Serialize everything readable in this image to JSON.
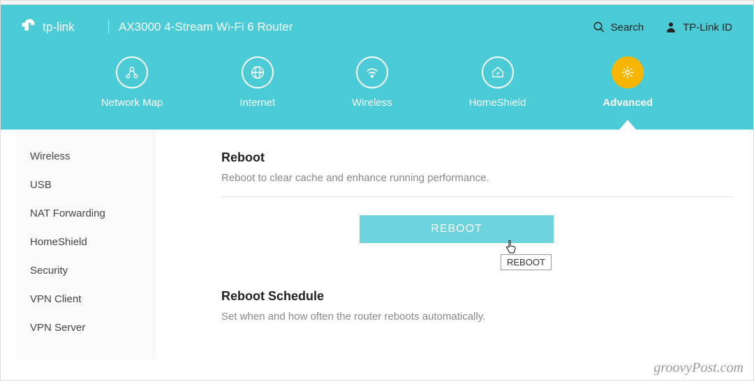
{
  "brand": {
    "name": "tp-link",
    "model": "AX3000 4-Stream Wi-Fi 6 Router"
  },
  "header_actions": {
    "search": "Search",
    "account": "TP-Link ID"
  },
  "nav": [
    {
      "id": "network-map",
      "label": "Network Map",
      "active": false
    },
    {
      "id": "internet",
      "label": "Internet",
      "active": false
    },
    {
      "id": "wireless",
      "label": "Wireless",
      "active": false
    },
    {
      "id": "homeshield",
      "label": "HomeShield",
      "active": false
    },
    {
      "id": "advanced",
      "label": "Advanced",
      "active": true
    }
  ],
  "sidebar": {
    "items": [
      {
        "label": "Wireless"
      },
      {
        "label": "USB"
      },
      {
        "label": "NAT Forwarding"
      },
      {
        "label": "HomeShield"
      },
      {
        "label": "Security"
      },
      {
        "label": "VPN Client"
      },
      {
        "label": "VPN Server"
      }
    ]
  },
  "main": {
    "reboot": {
      "title": "Reboot",
      "desc": "Reboot to clear cache and enhance running performance.",
      "button": "REBOOT",
      "tooltip": "REBOOT"
    },
    "schedule": {
      "title": "Reboot Schedule",
      "desc": "Set when and how often the router reboots automatically."
    }
  },
  "watermark": "groovyPost.com"
}
